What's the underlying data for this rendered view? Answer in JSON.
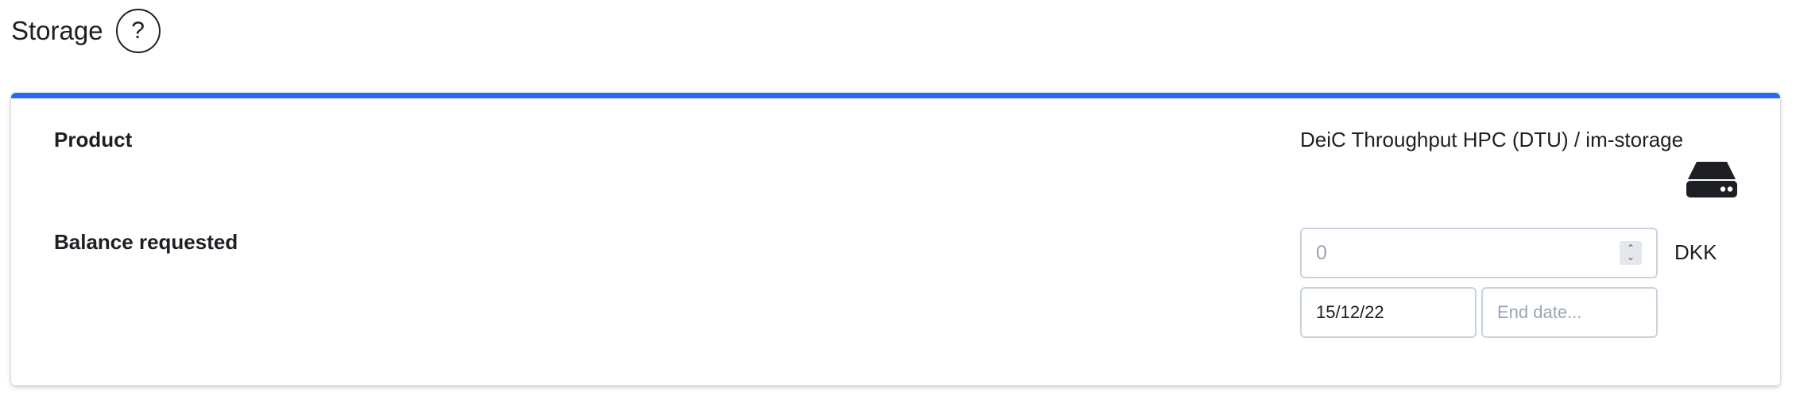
{
  "section": {
    "title": "Storage",
    "help_glyph": "?"
  },
  "card": {
    "accent_color": "#2c68f6",
    "product": {
      "label": "Product",
      "value": "DeiC Throughput HPC (DTU) / im-storage",
      "icon": "hard-drive-icon"
    },
    "balance": {
      "label": "Balance requested",
      "amount_value": "",
      "amount_placeholder": "0",
      "currency": "DKK",
      "start_date_value": "15/12/22",
      "end_date_value": "",
      "end_date_placeholder": "End date..."
    }
  }
}
